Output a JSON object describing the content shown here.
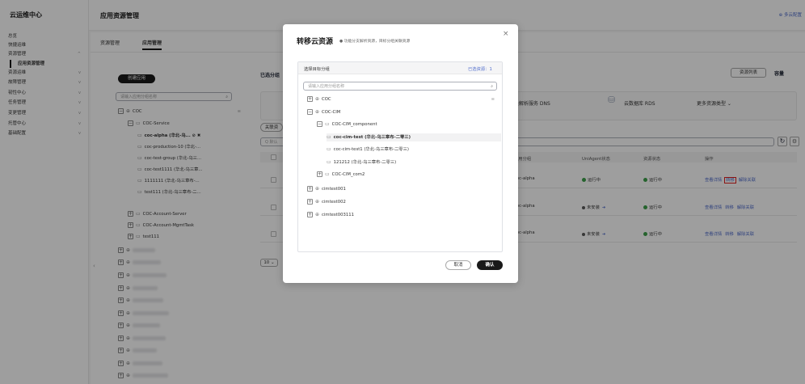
{
  "sidebar": {
    "title": "云运维中心",
    "items": [
      {
        "label": "总览",
        "chev": ""
      },
      {
        "label": "快捷运维",
        "chev": ""
      },
      {
        "label": "资源管理",
        "chev": "^"
      },
      {
        "label": "应用资源管理",
        "chev": ""
      },
      {
        "label": "资源运维",
        "chev": "v"
      },
      {
        "label": "故障管理",
        "chev": "v"
      },
      {
        "label": "韧性中心",
        "chev": "v"
      },
      {
        "label": "任务管理",
        "chev": "v"
      },
      {
        "label": "变更管理",
        "chev": "v"
      },
      {
        "label": "托管中心",
        "chev": "v"
      },
      {
        "label": "基础配置",
        "chev": "v"
      }
    ]
  },
  "header": {
    "title": "应用资源管理",
    "multi_cloud": "⊕ 多云配置"
  },
  "tabs": [
    "资源管理",
    "应用管理"
  ],
  "left_panel": {
    "create_button": "创建应用",
    "search_placeholder": "请输入应用分组名称",
    "tree": [
      {
        "indent": 0,
        "box": "−",
        "icon": "⊕",
        "label": "COC",
        "extra": "≡"
      },
      {
        "indent": 1,
        "box": "−",
        "icon": "▭",
        "label": "COC-Service"
      },
      {
        "indent": 2,
        "box": "",
        "icon": "▭",
        "label": "coc-alpha (华北-乌... ⊘ ✖",
        "bold": true
      },
      {
        "indent": 2,
        "box": "",
        "icon": "▭",
        "label": "coc-production-10 (华北-..."
      },
      {
        "indent": 2,
        "box": "",
        "icon": "▭",
        "label": "coc-test-group (华北-乌三..."
      },
      {
        "indent": 2,
        "box": "",
        "icon": "▭",
        "label": "coc-test1111 (华北-乌三章..."
      },
      {
        "indent": 2,
        "box": "",
        "icon": "▭",
        "label": "1111111 (华北-乌三章布-..."
      },
      {
        "indent": 2,
        "box": "",
        "icon": "▭",
        "label": "test111 (华北-乌三章布-二..."
      },
      {
        "indent": 1,
        "box": "+",
        "icon": "▭",
        "label": "COC-Account-Server"
      },
      {
        "indent": 1,
        "box": "+",
        "icon": "▭",
        "label": "COC-Account-MgmtTask"
      },
      {
        "indent": 1,
        "box": "+",
        "icon": "▭",
        "label": "test111"
      }
    ]
  },
  "main": {
    "selected_group_label": "已选分组",
    "resource_list_button": "资源列表",
    "capacity_tab": "容量",
    "dns_label": "云解析服务 DNS",
    "rds_label": "云数据库 RDS",
    "more_types": "更多资源类型 ⌄",
    "associate_button": "关联资",
    "search_hint": "Q 默认",
    "page_size": "10 ⌄",
    "columns": [
      "应用分组",
      "UniAgent状态",
      "资源状态",
      "操作"
    ],
    "rows": [
      {
        "group": "coc-alpha",
        "agent": "运行中",
        "agent_type": "green",
        "status": "运行中",
        "ops": [
          "查看详情",
          "转移",
          "解除关联"
        ]
      },
      {
        "group": "coc-alpha",
        "agent": "未安装",
        "agent_type": "none",
        "status": "运行中",
        "ops": [
          "查看详情",
          "转移",
          "解除关联"
        ]
      },
      {
        "group": "coc-alpha",
        "agent": "未安装",
        "agent_type": "none",
        "status": "运行中",
        "ops": [
          "查看详情",
          "转移",
          "解除关联"
        ]
      }
    ]
  },
  "modal": {
    "title": "转移云资源",
    "hint": "● 功能分支解析资源，目标分组关联资源",
    "close": "×",
    "panel_title": "选择目标分组",
    "selected_count": "已选资源：1",
    "search_placeholder": "请输入应用分组名称",
    "tree": [
      {
        "indent": 0,
        "box": "+",
        "icon": "⊕",
        "label": "COC",
        "extra": "≡"
      },
      {
        "indent": 0,
        "box": "−",
        "icon": "⊕",
        "label": "COC-CIM"
      },
      {
        "indent": 1,
        "box": "−",
        "icon": "▭",
        "label": "COC-CIM_component"
      },
      {
        "indent": 2,
        "box": "",
        "icon": "▭",
        "label": "coc-cim-test (华北-乌三章布-二零三)",
        "selected": true
      },
      {
        "indent": 2,
        "box": "",
        "icon": "▭",
        "label": "coc-cim-test1 (华北-乌三章布-二零三)"
      },
      {
        "indent": 2,
        "box": "",
        "icon": "▭",
        "label": "121212 (华北-乌三章布-二零三)"
      },
      {
        "indent": 1,
        "box": "+",
        "icon": "▭",
        "label": "COC-CIM_com2"
      },
      {
        "indent": 0,
        "box": "+",
        "icon": "⊕",
        "label": "cimtest001"
      },
      {
        "indent": 0,
        "box": "+",
        "icon": "⊕",
        "label": "cimtest002"
      },
      {
        "indent": 0,
        "box": "+",
        "icon": "⊕",
        "label": "cimtest003111"
      }
    ],
    "cancel": "取消",
    "confirm": "确认"
  }
}
